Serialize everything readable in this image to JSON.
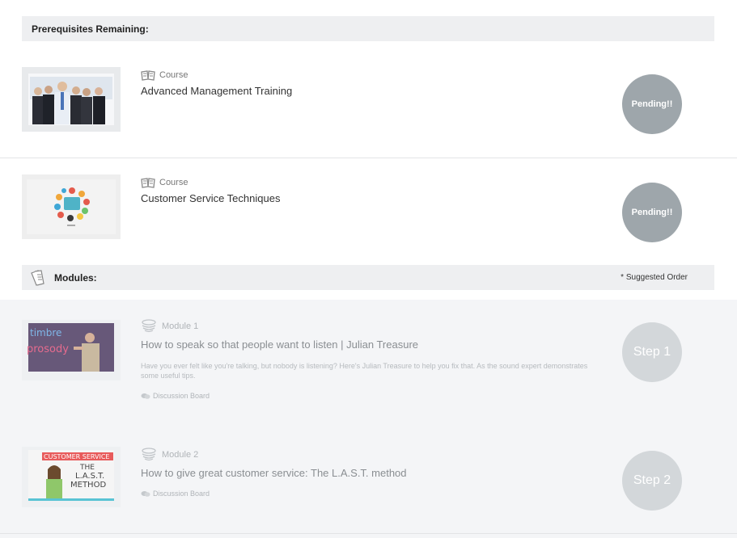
{
  "prerequisites": {
    "header": "Prerequisites Remaining:",
    "items": [
      {
        "kind": "Course",
        "title": "Advanced Management Training",
        "status": "Pending!!",
        "kind_icon": "book-icon"
      },
      {
        "kind": "Course",
        "title": "Customer Service Techniques",
        "status": "Pending!!",
        "kind_icon": "book-icon"
      }
    ]
  },
  "modules": {
    "header": "Modules:",
    "suggested_order": "* Suggested Order",
    "items": [
      {
        "kind": "Module 1",
        "title": "How to speak so that people want to listen | Julian Treasure",
        "description": "Have you ever felt like you're talking, but nobody is listening? Here's Julian Treasure to help you fix that. As the sound expert demonstrates some useful tips.",
        "discussion": "Discussion Board",
        "step": "Step 1",
        "thumb_text_top": "timbre",
        "thumb_text_bottom": "prosody"
      },
      {
        "kind": "Module 2",
        "title": "How to give great customer service: The L.A.S.T. method",
        "discussion": "Discussion Board",
        "step": "Step 2",
        "thumb_banner": "CUSTOMER SERVICE",
        "thumb_line1": "THE",
        "thumb_line2": "L.A.S.T.",
        "thumb_line3": "METHOD"
      }
    ]
  },
  "colors": {
    "pending": "#9ea6ab",
    "step": "#d3d7da",
    "header_bg": "#eeeff1",
    "modules_bg": "#f4f5f7"
  }
}
